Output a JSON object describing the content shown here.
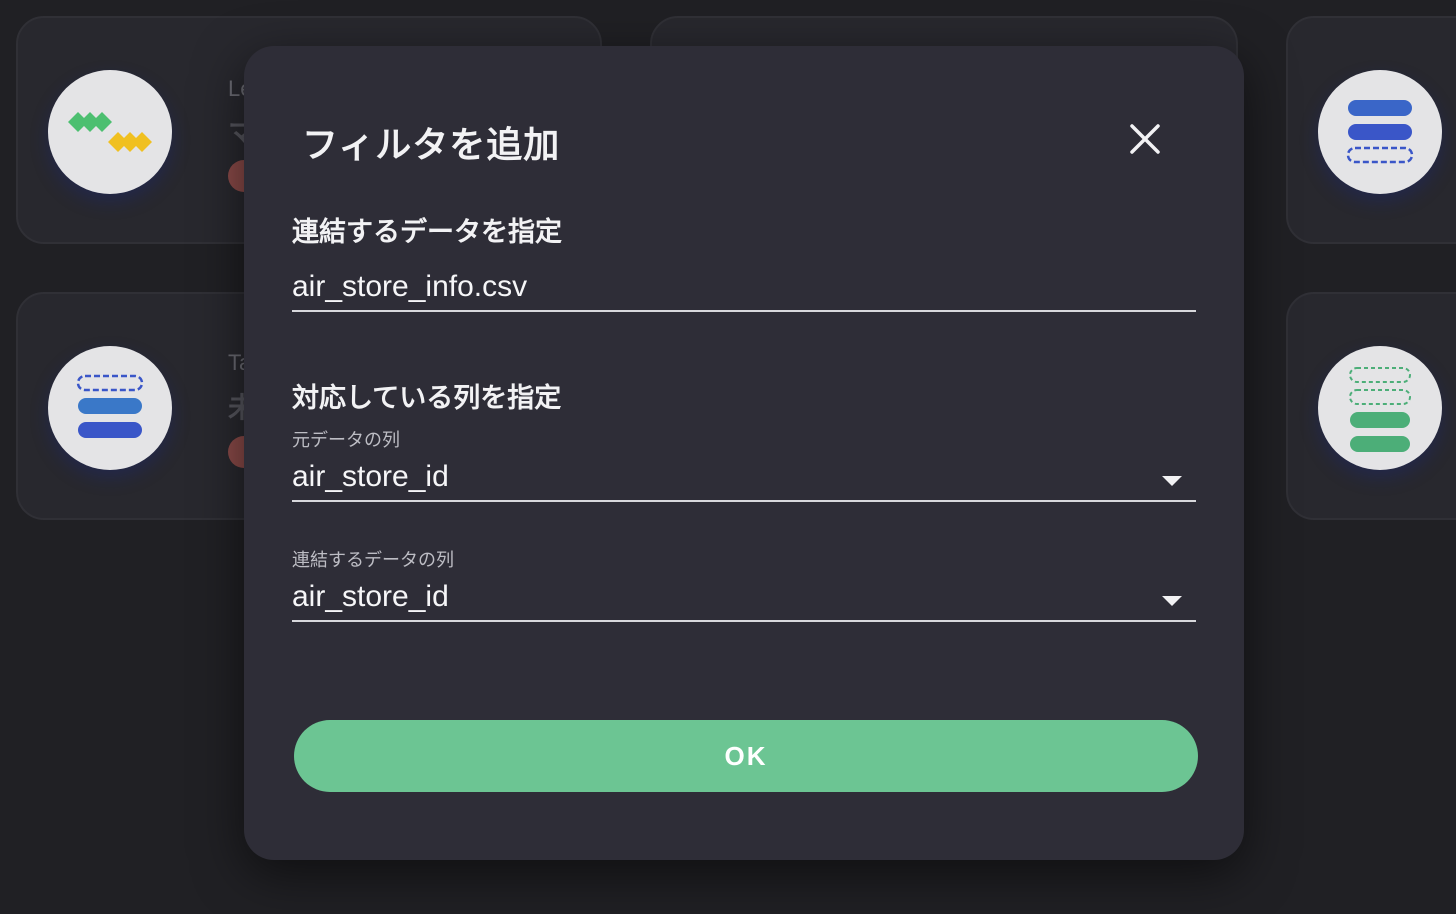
{
  "background": {
    "cards": [
      {
        "icon": "diamond-join-icon",
        "label_fragment": "Le",
        "title_fragment": "マ"
      },
      {
        "icon": "stacked-rows-icon",
        "label_fragment": "Ta",
        "title_fragment": "未"
      },
      {
        "icon": "stacked-rows-top-dashed-icon"
      },
      {
        "icon": "stacked-rows-dashed-green-icon"
      }
    ]
  },
  "dialog": {
    "title": "フィルタを追加",
    "close_icon": "close-icon",
    "section_data": {
      "heading": "連結するデータを指定",
      "file_value": "air_store_info.csv"
    },
    "section_columns": {
      "heading": "対応している列を指定",
      "source_label": "元データの列",
      "source_value": "air_store_id",
      "join_label": "連結するデータの列",
      "join_value": "air_store_id"
    },
    "ok_label": "OK"
  },
  "colors": {
    "page_bg": "#202024",
    "dialog_bg": "#2e2d37",
    "accent_green": "#6cc593"
  }
}
